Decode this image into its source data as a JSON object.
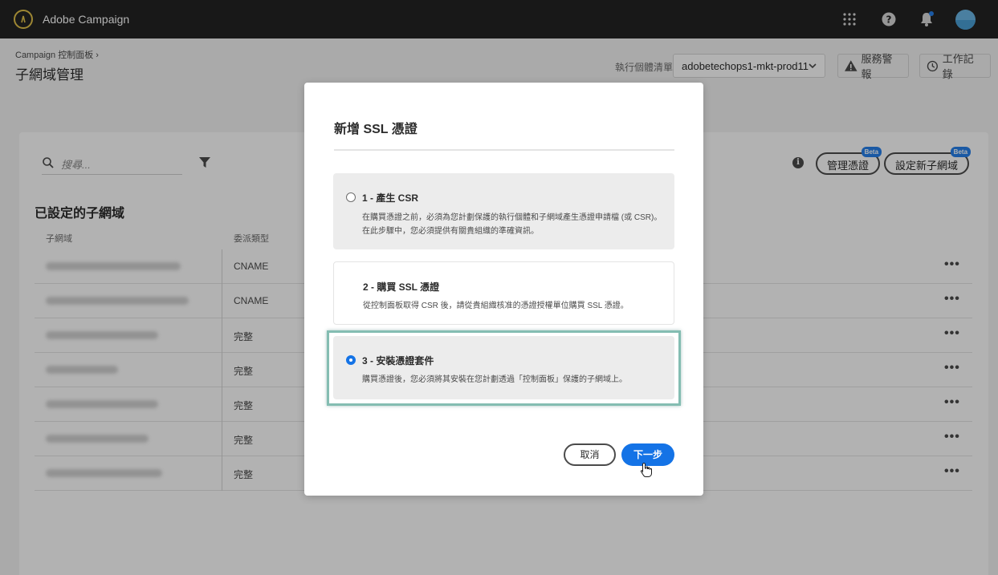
{
  "topbar": {
    "app_title": "Adobe Campaign",
    "icons": [
      "app-switcher-icon",
      "help-icon",
      "notifications-icon",
      "avatar"
    ],
    "notification_dot_color": "#2680eb"
  },
  "header": {
    "breadcrumb": "Campaign 控制面板",
    "breadcrumb_sep": "›",
    "title": "子網域管理",
    "instance_label": "執行個體清單",
    "instance_value": "adobetechops1-mkt-prod11",
    "alerts_label": "服務警報",
    "history_label": "工作記錄"
  },
  "toolbar": {
    "search_placeholder": "搜尋...",
    "manage_certs_label": "管理憑證",
    "new_subdomain_label": "設定新子網域",
    "beta_badge": "Beta"
  },
  "table": {
    "section_title": "已設定的子網域",
    "columns": [
      "子網域",
      "委派類型"
    ],
    "rows": [
      {
        "type": "CNAME"
      },
      {
        "type": "CNAME"
      },
      {
        "type": "完整"
      },
      {
        "type": "完整"
      },
      {
        "type": "完整"
      },
      {
        "type": "完整"
      },
      {
        "type": "完整"
      }
    ],
    "more_label": "•••"
  },
  "dialog": {
    "title": "新增 SSL 憑證",
    "options": [
      {
        "title": "1 - 產生 CSR",
        "desc": "在購買憑證之前，必須為您計劃保護的執行個體和子網域產生憑證申請檔 (或 CSR)。在此步驟中，您必須提供有關貴組織的準確資訊。",
        "selected": false
      },
      {
        "title": "2 - 購買 SSL 憑證",
        "desc": "從控制面板取得 CSR 後，請從貴組織核准的憑證授權單位購買 SSL 憑證。",
        "selected": false
      },
      {
        "title": "3 - 安裝憑證套件",
        "desc": "購買憑證後，您必須將其安裝在您計劃透過「控制面板」保護的子網域上。",
        "selected": true
      }
    ],
    "cancel_label": "取消",
    "next_label": "下一步",
    "accent_color": "#1473e6",
    "highlight_color": "#84bdb2"
  }
}
